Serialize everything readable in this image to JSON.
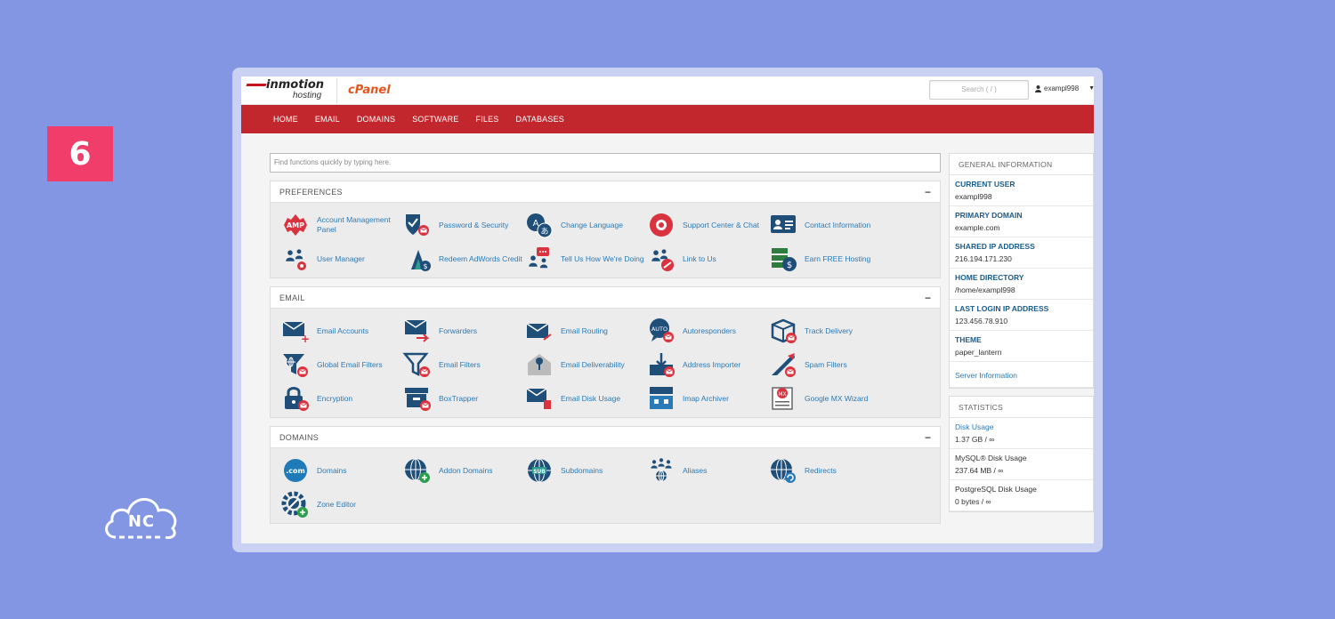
{
  "step_badge": "6",
  "watermark": "NC",
  "header": {
    "brand_main": "inmotion",
    "brand_sub": "hosting",
    "product": "cPanel",
    "search_placeholder": "Search ( / )",
    "username": "exampl998"
  },
  "nav": [
    "HOME",
    "EMAIL",
    "DOMAINS",
    "SOFTWARE",
    "FILES",
    "DATABASES"
  ],
  "find_placeholder": "Find functions quickly by typing here.",
  "sections": [
    {
      "title": "PREFERENCES",
      "items": [
        {
          "label": "Account Management Panel",
          "icon": "amp-icon"
        },
        {
          "label": "Password & Security",
          "icon": "shield-icon"
        },
        {
          "label": "Change Language",
          "icon": "language-icon"
        },
        {
          "label": "Support Center & Chat",
          "icon": "lifebuoy-icon"
        },
        {
          "label": "Contact Information",
          "icon": "contact-card-icon"
        },
        {
          "label": "User Manager",
          "icon": "users-gear-icon"
        },
        {
          "label": "Redeem AdWords Credit",
          "icon": "adwords-icon"
        },
        {
          "label": "Tell Us How We're Doing",
          "icon": "feedback-icon"
        },
        {
          "label": "Link to Us",
          "icon": "link-users-icon"
        },
        {
          "label": "Earn FREE Hosting",
          "icon": "server-dollar-icon"
        }
      ]
    },
    {
      "title": "EMAIL",
      "items": [
        {
          "label": "Email Accounts",
          "icon": "email-plus-icon"
        },
        {
          "label": "Forwarders",
          "icon": "email-forward-icon"
        },
        {
          "label": "Email Routing",
          "icon": "email-route-icon"
        },
        {
          "label": "Autoresponders",
          "icon": "auto-bubble-icon"
        },
        {
          "label": "Track Delivery",
          "icon": "box-icon"
        },
        {
          "label": "Global Email Filters",
          "icon": "globe-filter-icon"
        },
        {
          "label": "Email Filters",
          "icon": "filter-icon"
        },
        {
          "label": "Email Deliverability",
          "icon": "key-envelope-icon"
        },
        {
          "label": "Address Importer",
          "icon": "import-icon"
        },
        {
          "label": "Spam Filters",
          "icon": "spam-icon"
        },
        {
          "label": "Encryption",
          "icon": "lock-icon"
        },
        {
          "label": "BoxTrapper",
          "icon": "boxtrapper-icon"
        },
        {
          "label": "Email Disk Usage",
          "icon": "email-trash-icon"
        },
        {
          "label": "Imap Archiver",
          "icon": "archive-icon"
        },
        {
          "label": "Google MX Wizard",
          "icon": "mx-wizard-icon"
        }
      ]
    },
    {
      "title": "DOMAINS",
      "items": [
        {
          "label": "Domains",
          "icon": "dotcom-icon"
        },
        {
          "label": "Addon Domains",
          "icon": "globe-plus-icon"
        },
        {
          "label": "Subdomains",
          "icon": "sub-globe-icon"
        },
        {
          "label": "Aliases",
          "icon": "aliases-icon"
        },
        {
          "label": "Redirects",
          "icon": "globe-redirect-icon"
        },
        {
          "label": "Zone Editor",
          "icon": "gear-pencil-icon"
        }
      ]
    }
  ],
  "general_info": {
    "title": "GENERAL INFORMATION",
    "rows": [
      {
        "key": "CURRENT USER",
        "value": "exampl998"
      },
      {
        "key": "PRIMARY DOMAIN",
        "value": "example.com"
      },
      {
        "key": "SHARED IP ADDRESS",
        "value": "216.194.171.230"
      },
      {
        "key": "HOME DIRECTORY",
        "value": "/home/exampl998"
      },
      {
        "key": "LAST LOGIN IP ADDRESS",
        "value": "123.456.78.910"
      },
      {
        "key": "THEME",
        "value": "paper_lantern"
      }
    ],
    "link": "Server Information"
  },
  "statistics": {
    "title": "STATISTICS",
    "rows": [
      {
        "key": "Disk Usage",
        "value": "1.37 GB / ∞",
        "link": true
      },
      {
        "key": "MySQL® Disk Usage",
        "value": "237.64 MB / ∞",
        "link": false
      },
      {
        "key": "PostgreSQL Disk Usage",
        "value": "0 bytes / ∞",
        "link": false
      }
    ]
  },
  "colors": {
    "nav_red": "#c1272d",
    "icon_navy": "#1f4e79",
    "badge_red": "#d9333f",
    "link_blue": "#2a7ab8",
    "bg_purple": "#8296e3"
  }
}
